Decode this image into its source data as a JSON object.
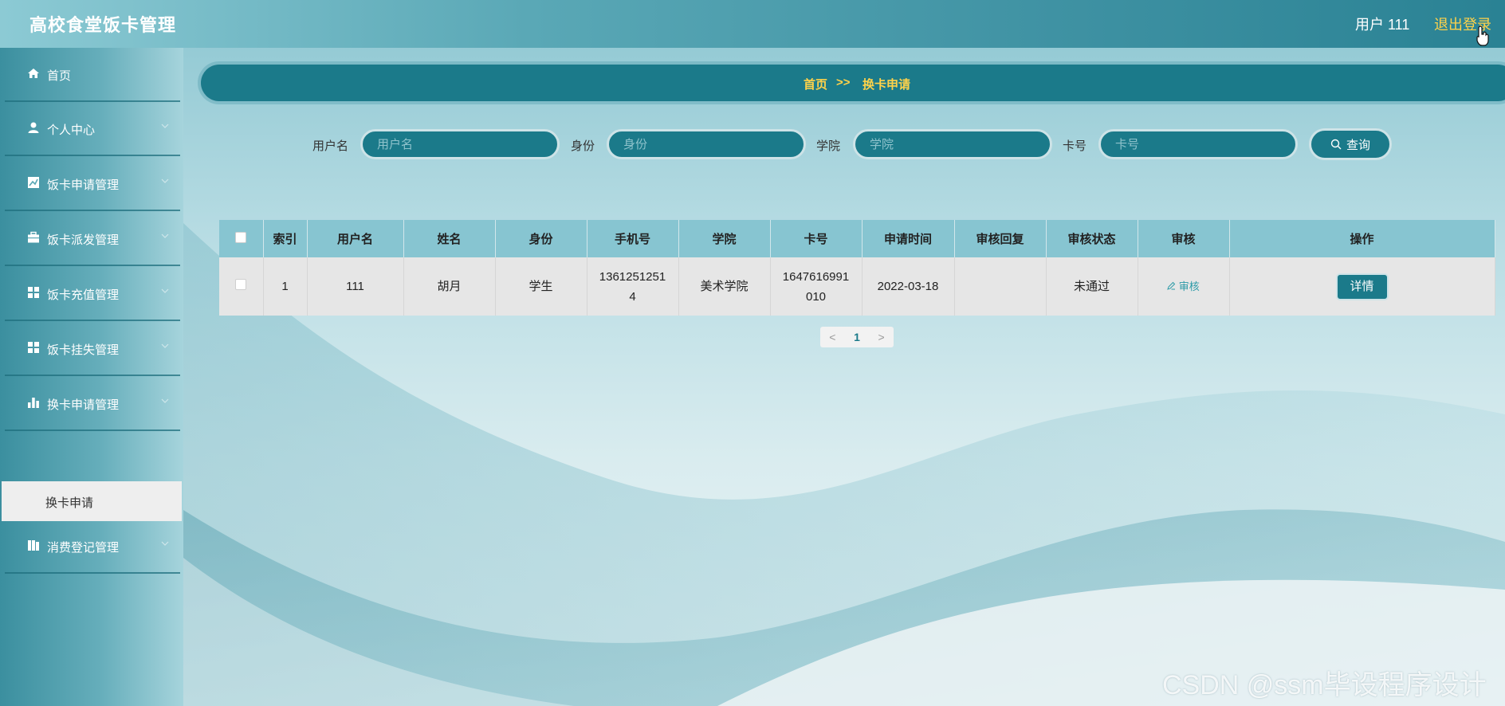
{
  "header": {
    "app_title": "高校食堂饭卡管理",
    "user_label": "用户 111",
    "logout_label": "退出登录"
  },
  "sidebar": {
    "items": [
      {
        "label": "首页",
        "icon": "home-icon",
        "has_submenu": false
      },
      {
        "label": "个人中心",
        "icon": "user-icon",
        "has_submenu": true
      },
      {
        "label": "饭卡申请管理",
        "icon": "chart-icon",
        "has_submenu": true
      },
      {
        "label": "饭卡派发管理",
        "icon": "briefcase-icon",
        "has_submenu": true
      },
      {
        "label": "饭卡充值管理",
        "icon": "grid-icon",
        "has_submenu": true
      },
      {
        "label": "饭卡挂失管理",
        "icon": "grid-icon",
        "has_submenu": true
      },
      {
        "label": "换卡申请管理",
        "icon": "bar-chart-icon",
        "has_submenu": true,
        "expanded": true
      },
      {
        "label": "消费登记管理",
        "icon": "book-icon",
        "has_submenu": true
      }
    ],
    "active_sub_item": "换卡申请"
  },
  "breadcrumb": {
    "home": "首页",
    "separator": ">>",
    "current": "换卡申请"
  },
  "search": {
    "fields": [
      {
        "label": "用户名",
        "placeholder": "用户名",
        "value": ""
      },
      {
        "label": "身份",
        "placeholder": "身份",
        "value": ""
      },
      {
        "label": "学院",
        "placeholder": "学院",
        "value": ""
      },
      {
        "label": "卡号",
        "placeholder": "卡号",
        "value": ""
      }
    ],
    "query_label": "查询"
  },
  "table": {
    "columns": [
      "索引",
      "用户名",
      "姓名",
      "身份",
      "手机号",
      "学院",
      "卡号",
      "申请时间",
      "审核回复",
      "审核状态",
      "审核",
      "操作"
    ],
    "rows": [
      {
        "index": "1",
        "username": "111",
        "name": "胡月",
        "identity": "学生",
        "phone_line1": "1361251251",
        "phone_line2": "4",
        "college": "美术学院",
        "card_line1": "1647616991",
        "card_line2": "010",
        "apply_time": "2022-03-18",
        "review_reply": "",
        "review_status": "未通过",
        "review_action": "审核",
        "detail_label": "详情"
      }
    ]
  },
  "pagination": {
    "current_page": "1",
    "prev": "<",
    "next": ">"
  },
  "watermark": "CSDN @ssm毕设程序设计",
  "colors": {
    "accent": "#1b7a8a",
    "highlight": "#ffd24a",
    "table_header": "#87c5d1"
  }
}
